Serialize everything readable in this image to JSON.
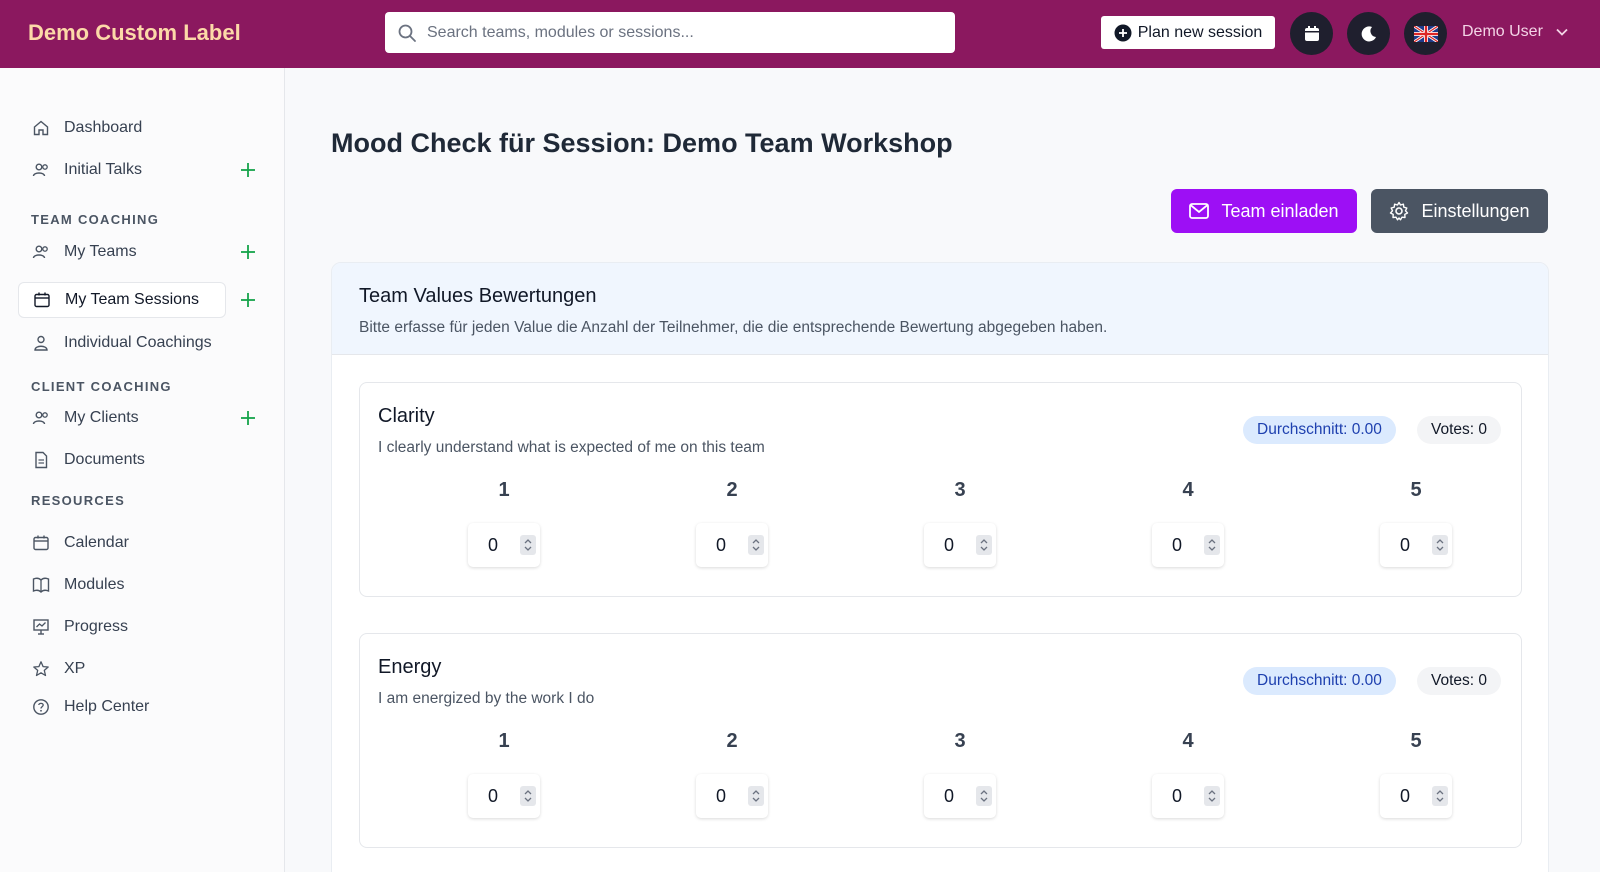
{
  "header": {
    "brand": "Demo Custom Label",
    "search_placeholder": "Search teams, modules or sessions...",
    "plan_button": "Plan new session",
    "user_name": "Demo User",
    "accent": "#8b185f"
  },
  "sidebar": {
    "dashboard": "Dashboard",
    "initial_talks": "Initial Talks",
    "section_team": "TEAM COACHING",
    "my_teams": "My Teams",
    "my_team_sessions": "My Team Sessions",
    "individual_coachings": "Individual Coachings",
    "section_client": "CLIENT COACHING",
    "my_clients": "My Clients",
    "documents": "Documents",
    "section_resources": "RESOURCES",
    "calendar": "Calendar",
    "modules": "Modules",
    "progress": "Progress",
    "xp": "XP",
    "help_center": "Help Center"
  },
  "main": {
    "title": "Mood Check für Session: Demo Team Workshop",
    "invite_button": "Team einladen",
    "settings_button": "Einstellungen",
    "card_title": "Team Values Bewertungen",
    "card_subtitle": "Bitte erfasse für jeden Value die Anzahl der Teilnehmer, die die entsprechende Bewertung abgegeben haben.",
    "values": [
      {
        "name": "Clarity",
        "description": "I clearly understand what is expected of me on this team",
        "average": "Durchschnitt: 0.00",
        "votes": "Votes: 0",
        "ratings": [
          {
            "label": "1",
            "count": "0"
          },
          {
            "label": "2",
            "count": "0"
          },
          {
            "label": "3",
            "count": "0"
          },
          {
            "label": "4",
            "count": "0"
          },
          {
            "label": "5",
            "count": "0"
          }
        ]
      },
      {
        "name": "Energy",
        "description": "I am energized by the work I do",
        "average": "Durchschnitt: 0.00",
        "votes": "Votes: 0",
        "ratings": [
          {
            "label": "1",
            "count": "0"
          },
          {
            "label": "2",
            "count": "0"
          },
          {
            "label": "3",
            "count": "0"
          },
          {
            "label": "4",
            "count": "0"
          },
          {
            "label": "5",
            "count": "0"
          }
        ]
      }
    ]
  }
}
